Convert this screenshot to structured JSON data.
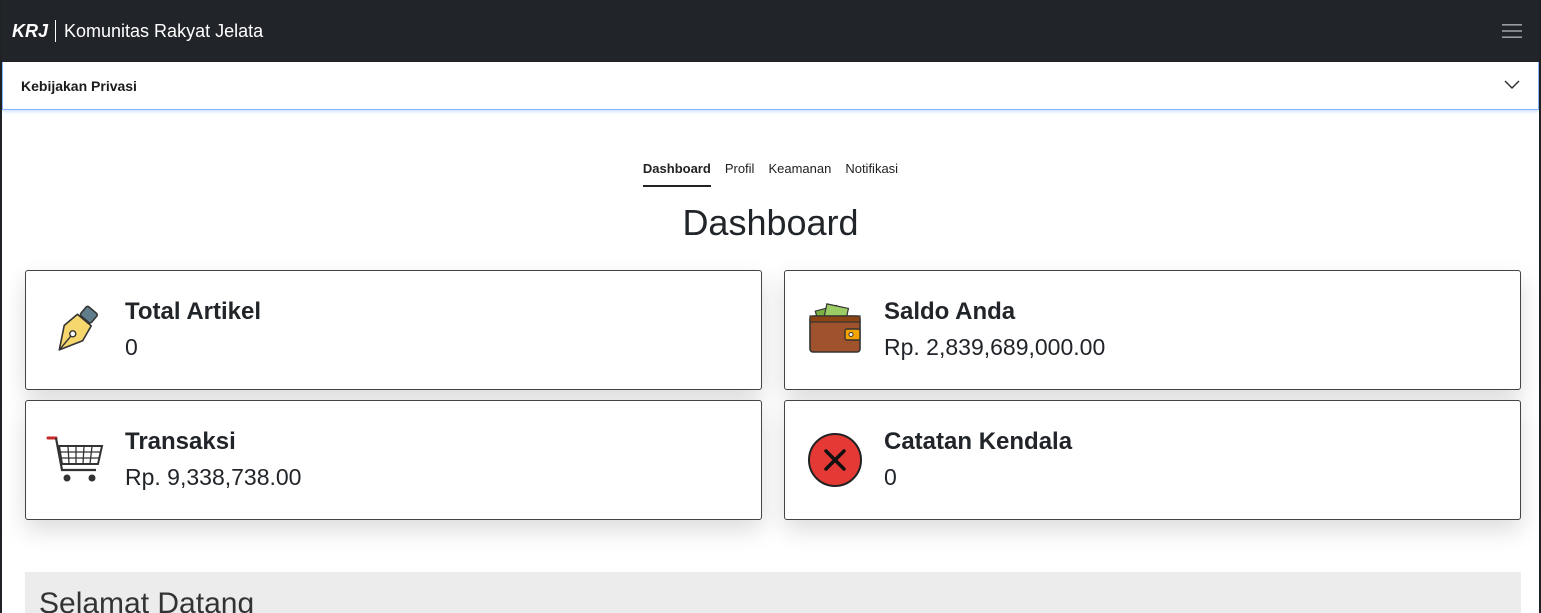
{
  "navbar": {
    "brand_short": "KRJ",
    "brand_long": "Komunitas Rakyat Jelata",
    "menu_icon": "hamburger-icon"
  },
  "accordion": {
    "label": "Kebijakan Privasi",
    "icon": "chevron-down-icon"
  },
  "tabs": [
    {
      "label": "Dashboard",
      "active": true
    },
    {
      "label": "Profil",
      "active": false
    },
    {
      "label": "Keamanan",
      "active": false
    },
    {
      "label": "Notifikasi",
      "active": false
    }
  ],
  "page_title": "Dashboard",
  "cards": [
    {
      "title": "Total Artikel",
      "value": "0",
      "icon": "pen-nib-icon"
    },
    {
      "title": "Saldo Anda",
      "value": "Rp. 2,839,689,000.00",
      "icon": "wallet-icon"
    },
    {
      "title": "Transaksi",
      "value": "Rp. 9,338,738.00",
      "icon": "shopping-cart-icon"
    },
    {
      "title": "Catatan Kendala",
      "value": "0",
      "icon": "error-x-icon"
    }
  ],
  "welcome": {
    "title": "Selamat Datang"
  },
  "colors": {
    "navbar_bg": "#212529",
    "accordion_focus": "#86b7fe",
    "error_red": "#e53935",
    "wallet_brown": "#a0522d",
    "welcome_bg": "#ececec"
  }
}
